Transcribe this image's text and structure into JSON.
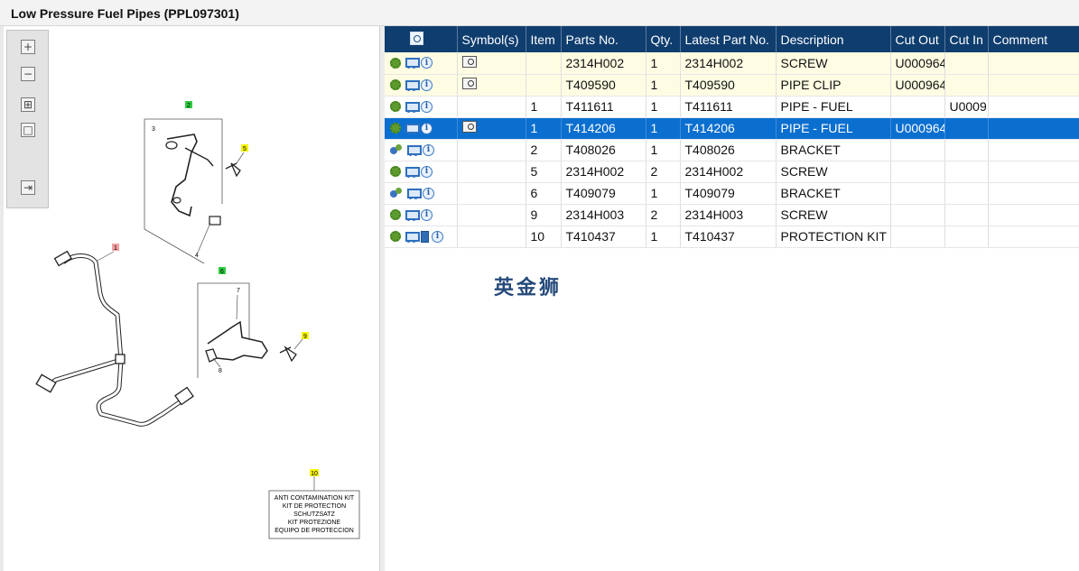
{
  "window": {
    "title": "Low Pressure Fuel Pipes (PPL097301)"
  },
  "toolbar": {
    "zoom_in": "+",
    "zoom_out": "−",
    "fit": "⊞",
    "actual": "□",
    "export": "⇥"
  },
  "diagram": {
    "callouts": {
      "c1": "1",
      "c2": "2",
      "c3": "3",
      "c4": "4",
      "c5": "5",
      "c6": "6",
      "c7": "7",
      "c8": "8",
      "c9": "9",
      "c10": "10"
    },
    "kit_label": {
      "line1": "ANTI CONTAMINATION KIT",
      "line2": "KIT DE PROTECTION",
      "line3": "SCHUTZSATZ",
      "line4": "KIT PROTEZIONE",
      "line5": "EQUIPO DE PROTECCION"
    }
  },
  "table": {
    "headers": {
      "symbols": "Symbol(s)",
      "item": "Item",
      "parts_no": "Parts No.",
      "qty": "Qty.",
      "latest": "Latest Part No.",
      "description": "Description",
      "cut_out": "Cut Out",
      "cut_in": "Cut In",
      "comment": "Comment"
    },
    "rows": [
      {
        "item": "",
        "parts_no": "2314H002",
        "qty": "1",
        "latest": "2314H002",
        "description": "SCREW",
        "cut_out": "U000964",
        "cut_in": "",
        "comment": ""
      },
      {
        "item": "",
        "parts_no": "T409590",
        "qty": "1",
        "latest": "T409590",
        "description": "PIPE CLIP",
        "cut_out": "U000964",
        "cut_in": "",
        "comment": ""
      },
      {
        "item": "1",
        "parts_no": "T411611",
        "qty": "1",
        "latest": "T411611",
        "description": "PIPE - FUEL",
        "cut_out": "",
        "cut_in": "U0009",
        "comment": ""
      },
      {
        "item": "1",
        "parts_no": "T414206",
        "qty": "1",
        "latest": "T414206",
        "description": "PIPE - FUEL",
        "cut_out": "U000964",
        "cut_in": "",
        "comment": ""
      },
      {
        "item": "2",
        "parts_no": "T408026",
        "qty": "1",
        "latest": "T408026",
        "description": "BRACKET",
        "cut_out": "",
        "cut_in": "",
        "comment": ""
      },
      {
        "item": "5",
        "parts_no": "2314H002",
        "qty": "2",
        "latest": "2314H002",
        "description": "SCREW",
        "cut_out": "",
        "cut_in": "",
        "comment": ""
      },
      {
        "item": "6",
        "parts_no": "T409079",
        "qty": "1",
        "latest": "T409079",
        "description": "BRACKET",
        "cut_out": "",
        "cut_in": "",
        "comment": ""
      },
      {
        "item": "9",
        "parts_no": "2314H003",
        "qty": "2",
        "latest": "2314H003",
        "description": "SCREW",
        "cut_out": "",
        "cut_in": "",
        "comment": ""
      },
      {
        "item": "10",
        "parts_no": "T410437",
        "qty": "1",
        "latest": "T410437",
        "description": "PROTECTION KIT",
        "cut_out": "",
        "cut_in": "",
        "comment": ""
      }
    ]
  },
  "watermark": "英金狮",
  "colors": {
    "header": "#0f3d6e",
    "selected": "#0b6fd0",
    "highlight": "#fefde3"
  }
}
